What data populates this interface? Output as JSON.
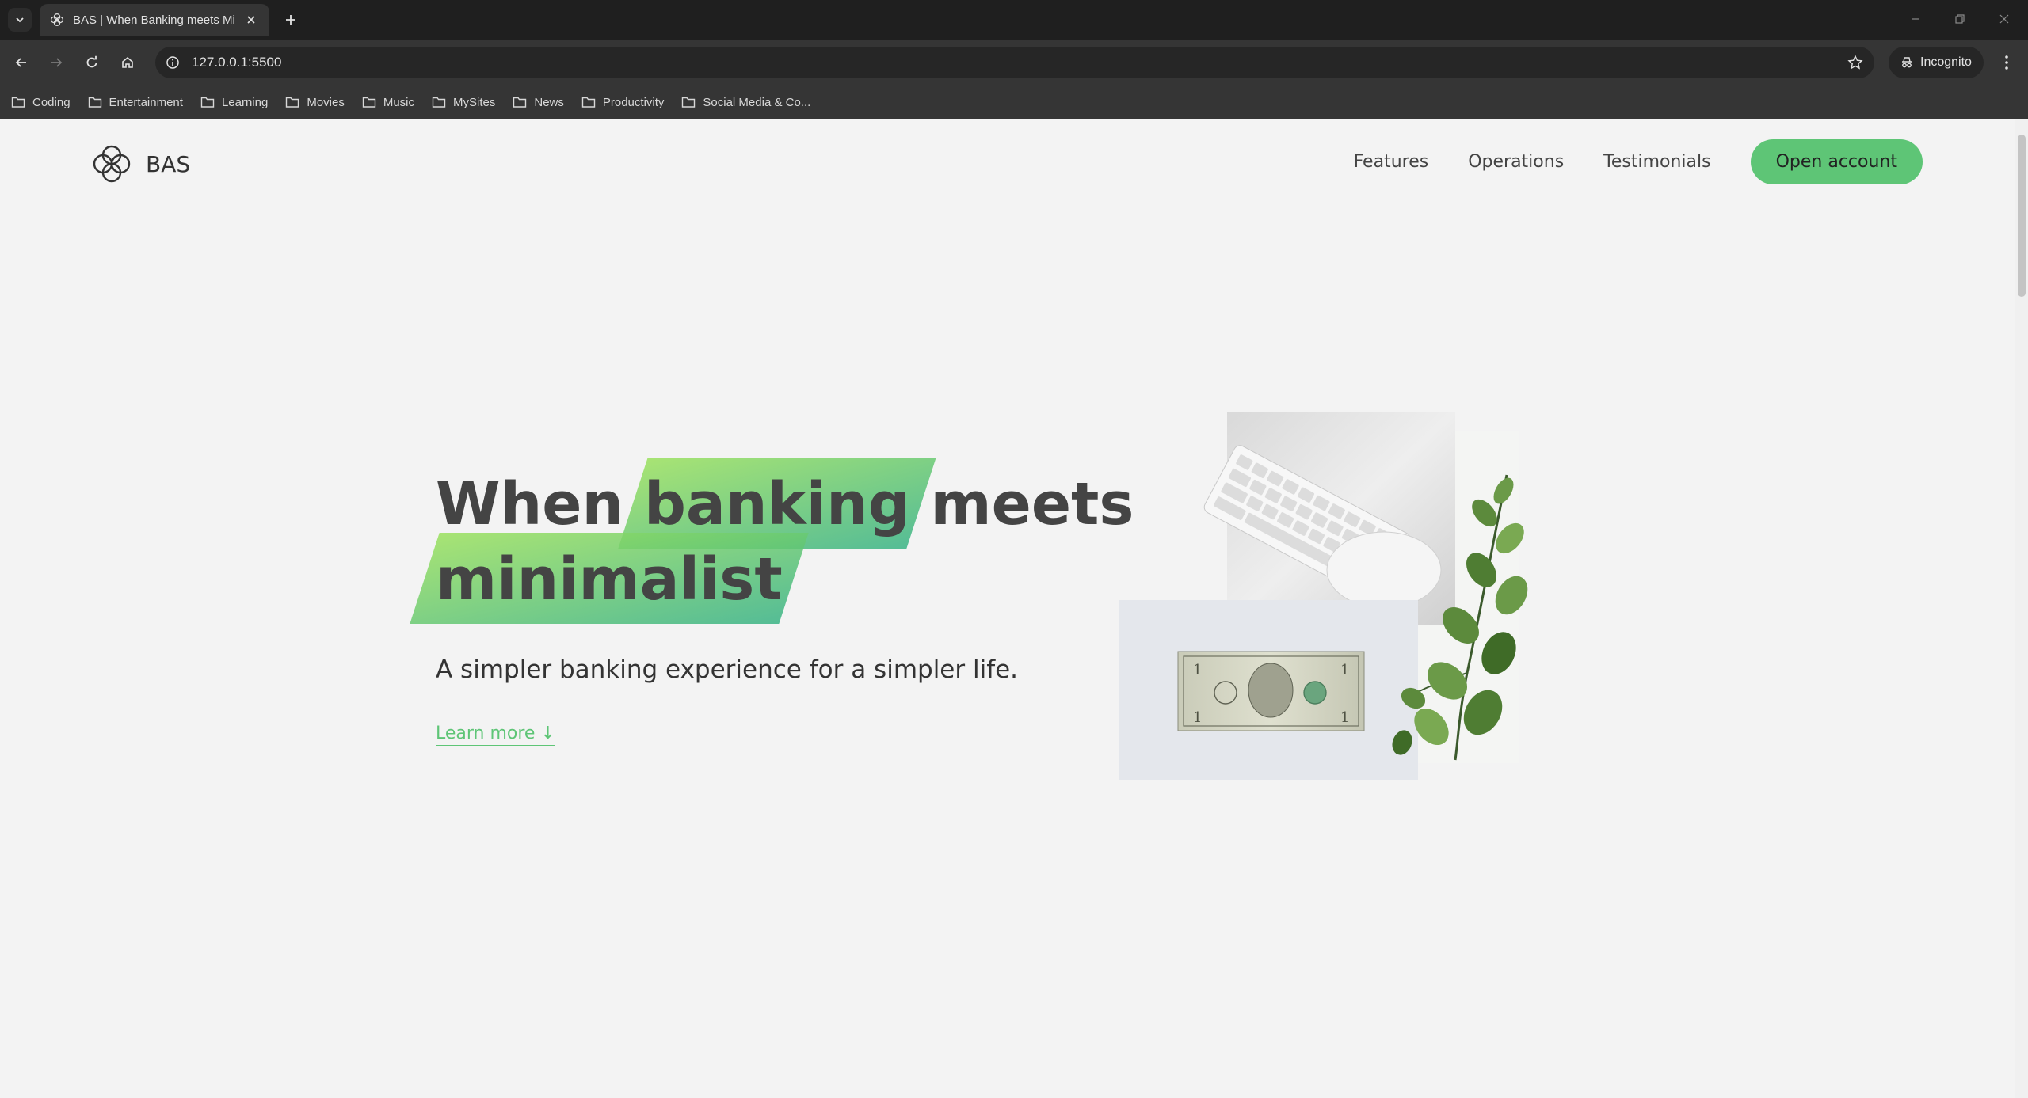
{
  "browser": {
    "tab_title": "BAS | When Banking meets Minimalist",
    "url": "127.0.0.1:5500",
    "incognito_label": "Incognito",
    "bookmarks": [
      "Coding",
      "Entertainment",
      "Learning",
      "Movies",
      "Music",
      "MySites",
      "News",
      "Productivity",
      "Social Media & Co..."
    ]
  },
  "header": {
    "logo_text": "BAS",
    "nav": [
      "Features",
      "Operations",
      "Testimonials"
    ],
    "cta_label": "Open account"
  },
  "hero": {
    "title_word_1": "When",
    "title_highlight_1": "banking",
    "title_word_2": "meets",
    "title_highlight_2": "minimalist",
    "subtitle": "A simpler banking experience for a simpler life.",
    "learn_more": "Learn more ↓"
  },
  "colors": {
    "accent": "#5ec576",
    "gradient_start": "#9be15d",
    "gradient_end": "#39b385",
    "page_bg": "#f3f3f3",
    "text": "#444444"
  }
}
